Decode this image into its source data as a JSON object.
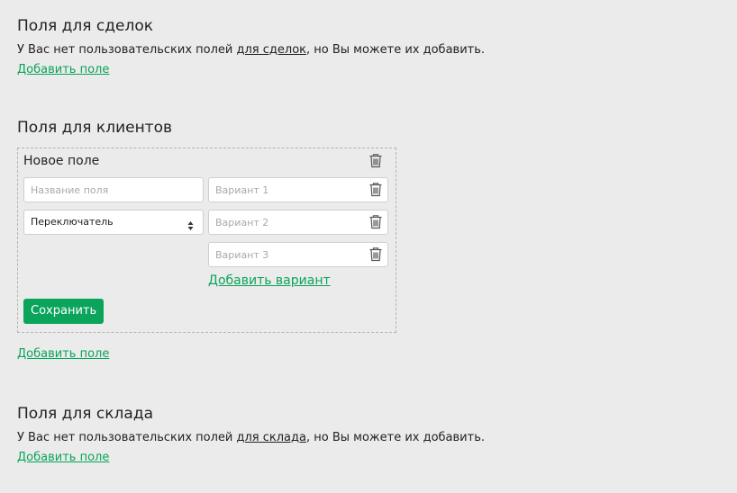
{
  "deals": {
    "title": "Поля для сделок",
    "note_before": "У Вас нет пользовательских полей ",
    "note_link": "для сделок",
    "note_after": ", но Вы можете их добавить.",
    "add_label": "Добавить поле"
  },
  "clients": {
    "title": "Поля для клиентов",
    "card": {
      "title": "Новое поле",
      "name_placeholder": "Название поля",
      "type_value": "Переключатель",
      "variants": [
        {
          "placeholder": "Вариант 1"
        },
        {
          "placeholder": "Вариант 2"
        },
        {
          "placeholder": "Вариант 3"
        }
      ],
      "add_variant_label": "Добавить вариант",
      "save_label": "Сохранить"
    },
    "add_label": "Добавить поле"
  },
  "warehouse": {
    "title": "Поля для склада",
    "note_before": "У Вас нет пользовательских полей ",
    "note_link": "для склада",
    "note_after": ", но Вы можете их добавить.",
    "add_label": "Добавить поле"
  },
  "icons": {
    "delete": "trash-icon",
    "select": "select-arrows-icon"
  },
  "colors": {
    "accent": "#0aa45a",
    "background": "#ebebeb",
    "text": "#222222",
    "icon": "#555555"
  }
}
